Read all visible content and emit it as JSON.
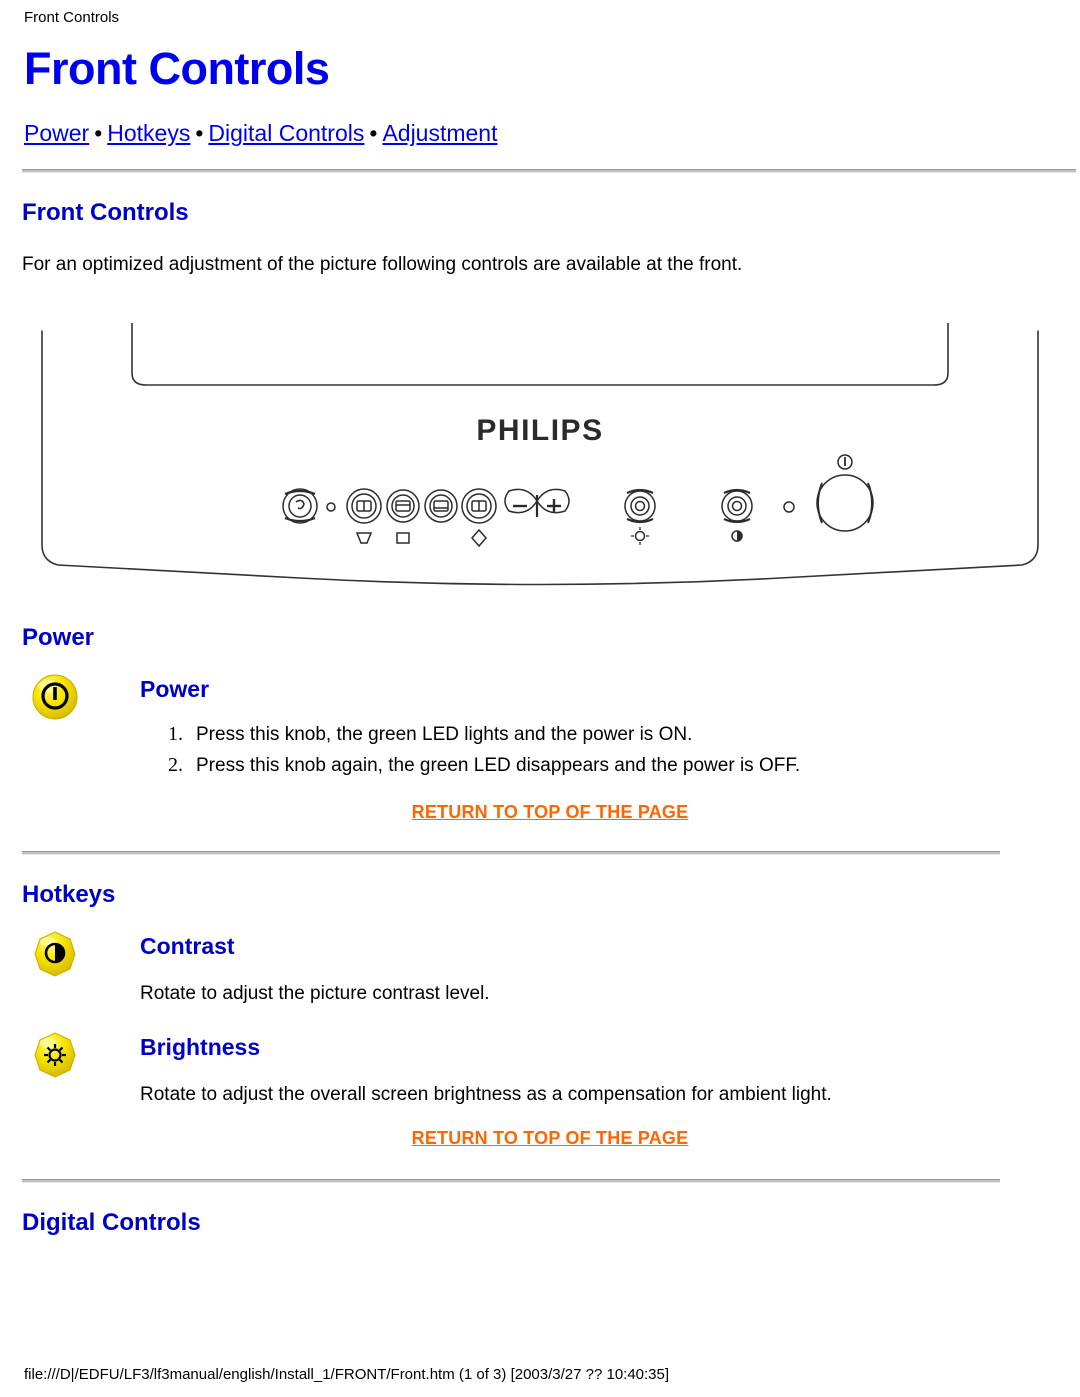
{
  "window": {
    "breadcrumb": "Front Controls"
  },
  "header": {
    "title": "Front Controls"
  },
  "nav": {
    "separator": "•",
    "links": [
      {
        "label": "Power"
      },
      {
        "label": "Hotkeys"
      },
      {
        "label": "Digital Controls"
      },
      {
        "label": "Adjustment"
      }
    ]
  },
  "intro": {
    "heading": "Front Controls",
    "paragraph": "For an optimized adjustment of the picture following controls are available at the front."
  },
  "illustration": {
    "brand": "PHILIPS",
    "alt": "philips-monitor-front-panel"
  },
  "sections": [
    {
      "id": "power",
      "heading": "Power",
      "items": [
        {
          "icon": "power-button-icon",
          "title": "Power",
          "steps": [
            "Press this knob, the green LED lights and the power is ON.",
            "Press this knob again, the green LED disappears and the power is OFF."
          ]
        }
      ],
      "return_link": "RETURN TO TOP OF THE PAGE"
    },
    {
      "id": "hotkeys",
      "heading": "Hotkeys",
      "items": [
        {
          "icon": "contrast-icon",
          "title": "Contrast",
          "description": "Rotate to adjust the picture contrast level."
        },
        {
          "icon": "brightness-icon",
          "title": "Brightness",
          "description": "Rotate to adjust the overall screen brightness as a compensation for ambient light."
        }
      ],
      "return_link": "RETURN TO TOP OF THE PAGE"
    },
    {
      "id": "digital-controls",
      "heading": "Digital Controls"
    }
  ],
  "footer": {
    "path": "file:///D|/EDFU/LF3/lf3manual/english/Install_1/FRONT/Front.htm (1 of 3) [2003/3/27 ?? 10:40:35]"
  },
  "colors": {
    "link_blue": "#0000EE",
    "heading_blue": "#0000CC",
    "return_orange": "#FF6600",
    "button_yellow": "#F5E400",
    "rule_gray": "#c0c0c0"
  }
}
